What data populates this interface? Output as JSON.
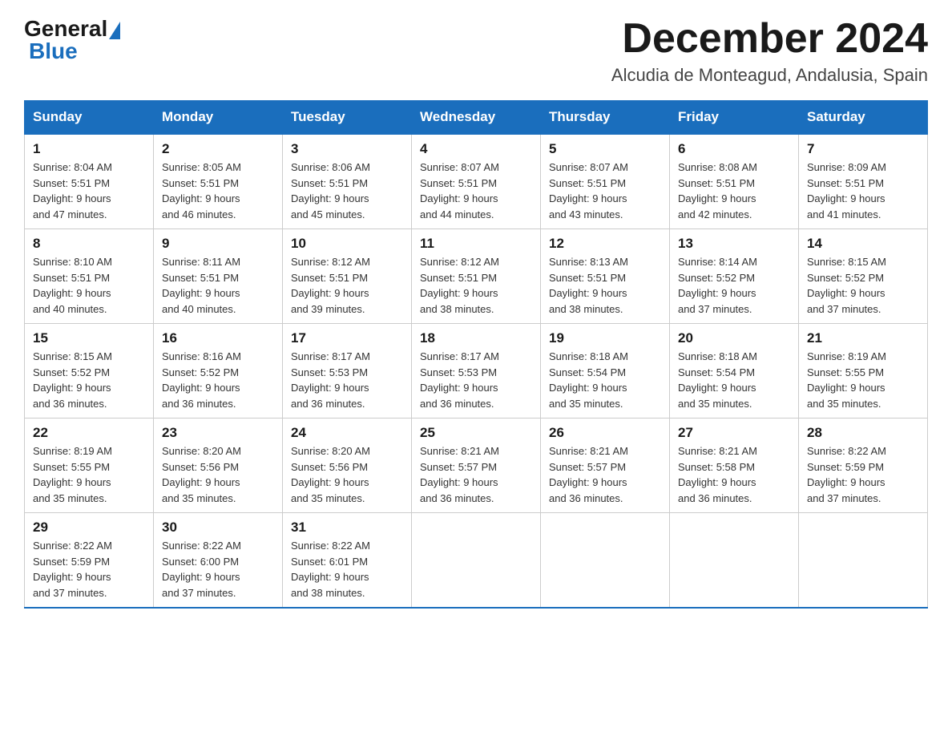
{
  "header": {
    "logo_general": "General",
    "logo_blue": "Blue",
    "title": "December 2024",
    "location": "Alcudia de Monteagud, Andalusia, Spain"
  },
  "days_of_week": [
    "Sunday",
    "Monday",
    "Tuesday",
    "Wednesday",
    "Thursday",
    "Friday",
    "Saturday"
  ],
  "weeks": [
    [
      {
        "day": "1",
        "info": "Sunrise: 8:04 AM\nSunset: 5:51 PM\nDaylight: 9 hours\nand 47 minutes."
      },
      {
        "day": "2",
        "info": "Sunrise: 8:05 AM\nSunset: 5:51 PM\nDaylight: 9 hours\nand 46 minutes."
      },
      {
        "day": "3",
        "info": "Sunrise: 8:06 AM\nSunset: 5:51 PM\nDaylight: 9 hours\nand 45 minutes."
      },
      {
        "day": "4",
        "info": "Sunrise: 8:07 AM\nSunset: 5:51 PM\nDaylight: 9 hours\nand 44 minutes."
      },
      {
        "day": "5",
        "info": "Sunrise: 8:07 AM\nSunset: 5:51 PM\nDaylight: 9 hours\nand 43 minutes."
      },
      {
        "day": "6",
        "info": "Sunrise: 8:08 AM\nSunset: 5:51 PM\nDaylight: 9 hours\nand 42 minutes."
      },
      {
        "day": "7",
        "info": "Sunrise: 8:09 AM\nSunset: 5:51 PM\nDaylight: 9 hours\nand 41 minutes."
      }
    ],
    [
      {
        "day": "8",
        "info": "Sunrise: 8:10 AM\nSunset: 5:51 PM\nDaylight: 9 hours\nand 40 minutes."
      },
      {
        "day": "9",
        "info": "Sunrise: 8:11 AM\nSunset: 5:51 PM\nDaylight: 9 hours\nand 40 minutes."
      },
      {
        "day": "10",
        "info": "Sunrise: 8:12 AM\nSunset: 5:51 PM\nDaylight: 9 hours\nand 39 minutes."
      },
      {
        "day": "11",
        "info": "Sunrise: 8:12 AM\nSunset: 5:51 PM\nDaylight: 9 hours\nand 38 minutes."
      },
      {
        "day": "12",
        "info": "Sunrise: 8:13 AM\nSunset: 5:51 PM\nDaylight: 9 hours\nand 38 minutes."
      },
      {
        "day": "13",
        "info": "Sunrise: 8:14 AM\nSunset: 5:52 PM\nDaylight: 9 hours\nand 37 minutes."
      },
      {
        "day": "14",
        "info": "Sunrise: 8:15 AM\nSunset: 5:52 PM\nDaylight: 9 hours\nand 37 minutes."
      }
    ],
    [
      {
        "day": "15",
        "info": "Sunrise: 8:15 AM\nSunset: 5:52 PM\nDaylight: 9 hours\nand 36 minutes."
      },
      {
        "day": "16",
        "info": "Sunrise: 8:16 AM\nSunset: 5:52 PM\nDaylight: 9 hours\nand 36 minutes."
      },
      {
        "day": "17",
        "info": "Sunrise: 8:17 AM\nSunset: 5:53 PM\nDaylight: 9 hours\nand 36 minutes."
      },
      {
        "day": "18",
        "info": "Sunrise: 8:17 AM\nSunset: 5:53 PM\nDaylight: 9 hours\nand 36 minutes."
      },
      {
        "day": "19",
        "info": "Sunrise: 8:18 AM\nSunset: 5:54 PM\nDaylight: 9 hours\nand 35 minutes."
      },
      {
        "day": "20",
        "info": "Sunrise: 8:18 AM\nSunset: 5:54 PM\nDaylight: 9 hours\nand 35 minutes."
      },
      {
        "day": "21",
        "info": "Sunrise: 8:19 AM\nSunset: 5:55 PM\nDaylight: 9 hours\nand 35 minutes."
      }
    ],
    [
      {
        "day": "22",
        "info": "Sunrise: 8:19 AM\nSunset: 5:55 PM\nDaylight: 9 hours\nand 35 minutes."
      },
      {
        "day": "23",
        "info": "Sunrise: 8:20 AM\nSunset: 5:56 PM\nDaylight: 9 hours\nand 35 minutes."
      },
      {
        "day": "24",
        "info": "Sunrise: 8:20 AM\nSunset: 5:56 PM\nDaylight: 9 hours\nand 35 minutes."
      },
      {
        "day": "25",
        "info": "Sunrise: 8:21 AM\nSunset: 5:57 PM\nDaylight: 9 hours\nand 36 minutes."
      },
      {
        "day": "26",
        "info": "Sunrise: 8:21 AM\nSunset: 5:57 PM\nDaylight: 9 hours\nand 36 minutes."
      },
      {
        "day": "27",
        "info": "Sunrise: 8:21 AM\nSunset: 5:58 PM\nDaylight: 9 hours\nand 36 minutes."
      },
      {
        "day": "28",
        "info": "Sunrise: 8:22 AM\nSunset: 5:59 PM\nDaylight: 9 hours\nand 37 minutes."
      }
    ],
    [
      {
        "day": "29",
        "info": "Sunrise: 8:22 AM\nSunset: 5:59 PM\nDaylight: 9 hours\nand 37 minutes."
      },
      {
        "day": "30",
        "info": "Sunrise: 8:22 AM\nSunset: 6:00 PM\nDaylight: 9 hours\nand 37 minutes."
      },
      {
        "day": "31",
        "info": "Sunrise: 8:22 AM\nSunset: 6:01 PM\nDaylight: 9 hours\nand 38 minutes."
      },
      {
        "day": "",
        "info": ""
      },
      {
        "day": "",
        "info": ""
      },
      {
        "day": "",
        "info": ""
      },
      {
        "day": "",
        "info": ""
      }
    ]
  ]
}
